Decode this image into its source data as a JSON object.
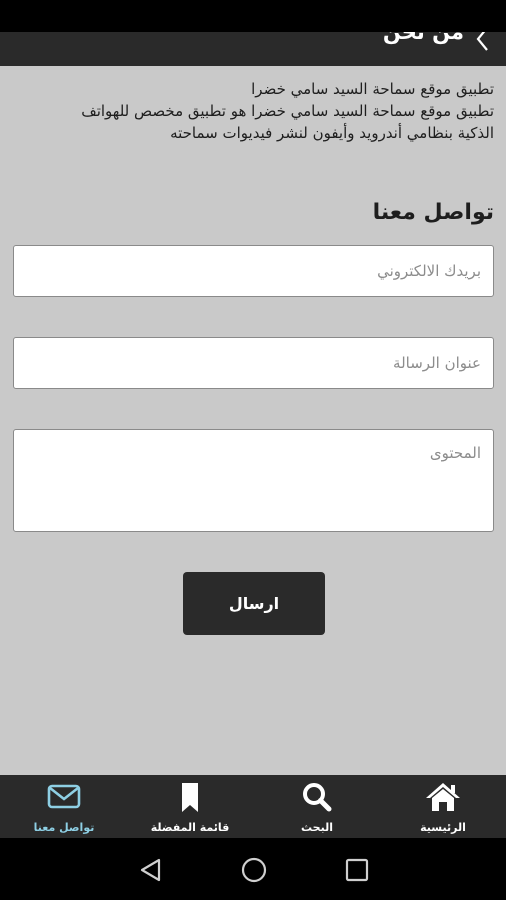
{
  "header": {
    "title": "من نحن",
    "back_icon": "chevron-left-icon"
  },
  "about": {
    "lines": [
      "تطبيق موقع  سماحة السيد سامي خضرا",
      "تطبيق موقع  سماحة السيد سامي خضرا  هو تطبيق مخصص للهواتف",
      "الذكية بنظامي أندرويد وأيفون لنشر فيديوات سماحته"
    ]
  },
  "contact": {
    "title": "تواصل معنا",
    "email_placeholder": "بريدك الالكتروني",
    "subject_placeholder": "عنوان الرسالة",
    "content_placeholder": "المحتوى",
    "send_label": "ارسال"
  },
  "bottom_nav": {
    "items": [
      {
        "label": "الرئيسية",
        "icon": "home-icon"
      },
      {
        "label": "البحث",
        "icon": "search-icon"
      },
      {
        "label": "قائمة المفضلة",
        "icon": "bookmark-icon"
      },
      {
        "label": "تواصل معنا",
        "icon": "mail-icon",
        "active": true
      }
    ]
  },
  "system_nav": {
    "buttons": [
      "back-icon",
      "home-circle-icon",
      "recents-icon"
    ]
  },
  "colors": {
    "background": "#c9c9c9",
    "bar": "#2a2a2a",
    "active": "#8ecfe4"
  }
}
